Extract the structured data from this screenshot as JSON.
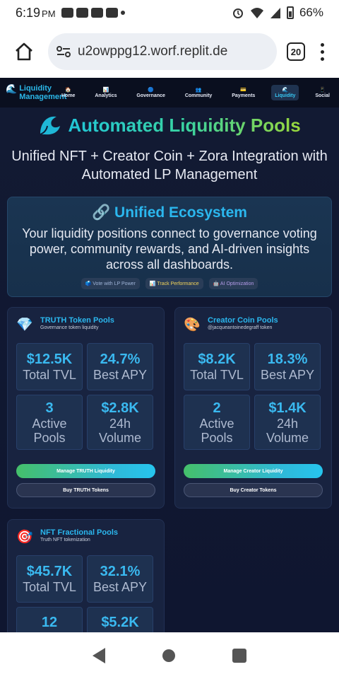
{
  "status_bar": {
    "time": "6:19",
    "ampm": "PM",
    "battery": "66%"
  },
  "browser": {
    "url": "u2owppg12.worf.replit.de",
    "tab_count": "20"
  },
  "nav": {
    "brand_line1": "Liquidity",
    "brand_line2": "Management",
    "items": [
      {
        "icon": "🏠",
        "label": "Home"
      },
      {
        "icon": "📊",
        "label": "Analytics"
      },
      {
        "icon": "🔵",
        "label": "Governance"
      },
      {
        "icon": "👥",
        "label": "Community"
      },
      {
        "icon": "💳",
        "label": "Payments"
      },
      {
        "icon": "🌊",
        "label": "Liquidity"
      },
      {
        "icon": "📱",
        "label": "Social"
      }
    ]
  },
  "hero": {
    "title": "Automated Liquidity Pools",
    "subtitle": "Unified NFT + Creator Coin + Zora Integration with Automated LP Management"
  },
  "ecosystem": {
    "title": "🔗 Unified Ecosystem",
    "description": "Your liquidity positions connect to governance voting power, community rewards, and AI-driven insights across all dashboards.",
    "tags": [
      "🗳️ Vote with LP Power",
      "📊 Track Performance",
      "🤖 AI Optimization"
    ]
  },
  "pools": [
    {
      "icon": "💎",
      "title": "TRUTH Token Pools",
      "subtitle": "Governance token liquidity",
      "stats": [
        {
          "value": "$12.5K",
          "label": "Total TVL"
        },
        {
          "value": "24.7%",
          "label": "Best APY"
        },
        {
          "value": "3",
          "label": "Active Pools"
        },
        {
          "value": "$2.8K",
          "label": "24h Volume"
        }
      ],
      "primary_button": "Manage TRUTH Liquidity",
      "secondary_button": "Buy TRUTH Tokens"
    },
    {
      "icon": "🎨",
      "title": "Creator Coin Pools",
      "subtitle": "@jacqueantoinedegraff token",
      "stats": [
        {
          "value": "$8.2K",
          "label": "Total TVL"
        },
        {
          "value": "18.3%",
          "label": "Best APY"
        },
        {
          "value": "2",
          "label": "Active Pools"
        },
        {
          "value": "$1.4K",
          "label": "24h Volume"
        }
      ],
      "primary_button": "Manage Creator Liquidity",
      "secondary_button": "Buy Creator Tokens"
    },
    {
      "icon": "🎯",
      "title": "NFT Fractional Pools",
      "subtitle": "Truth NFT tokenization",
      "stats": [
        {
          "value": "$45.7K",
          "label": "Total TVL"
        },
        {
          "value": "32.1%",
          "label": "Best APY"
        },
        {
          "value": "12",
          "label": ""
        },
        {
          "value": "$5.2K",
          "label": ""
        }
      ]
    }
  ]
}
